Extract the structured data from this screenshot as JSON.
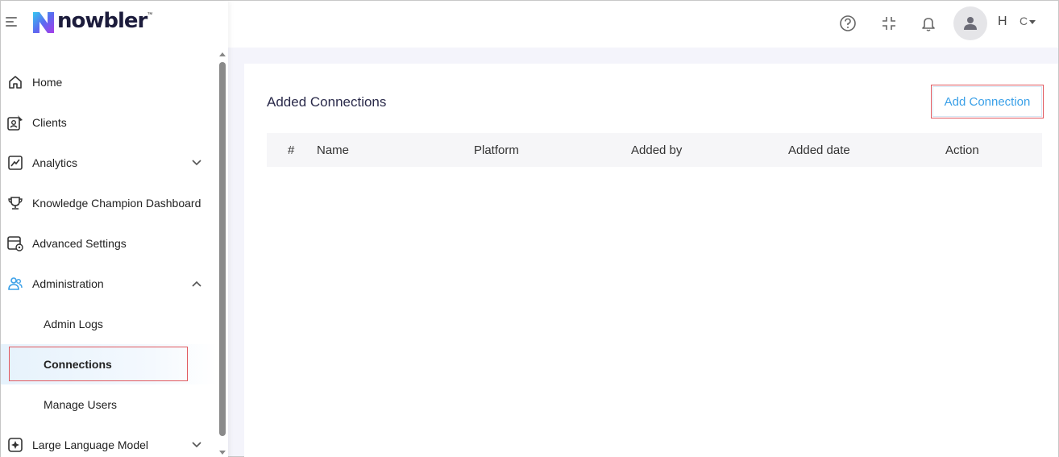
{
  "brand": {
    "name": "nowbler",
    "tm": "™"
  },
  "sidebar": {
    "items": [
      {
        "label": "Home"
      },
      {
        "label": "Clients"
      },
      {
        "label": "Analytics"
      },
      {
        "label": "Knowledge Champion Dashboard"
      },
      {
        "label": "Advanced Settings"
      },
      {
        "label": "Administration"
      },
      {
        "label": "Admin Logs"
      },
      {
        "label": "Connections"
      },
      {
        "label": "Manage Users"
      },
      {
        "label": "Large Language Model"
      }
    ],
    "active_item": "Connections"
  },
  "topbar": {
    "user_initial": "H",
    "user_extra": "C"
  },
  "main": {
    "title": "Added Connections",
    "add_button": "Add Connection",
    "table": {
      "columns": [
        "#",
        "Name",
        "Platform",
        "Added by",
        "Added date",
        "Action"
      ],
      "rows": []
    }
  },
  "colors": {
    "accent": "#3aa0e8",
    "highlight_border": "#e0585e",
    "background": "#f4f4fb",
    "admin_icon": "#3aa0e8"
  },
  "icons": [
    "hamburger-icon",
    "home-icon",
    "clients-icon",
    "analytics-icon",
    "trophy-icon",
    "settings-icon",
    "users-icon",
    "llm-icon",
    "help-icon",
    "collapse-icon",
    "bell-icon",
    "user-avatar-icon"
  ]
}
